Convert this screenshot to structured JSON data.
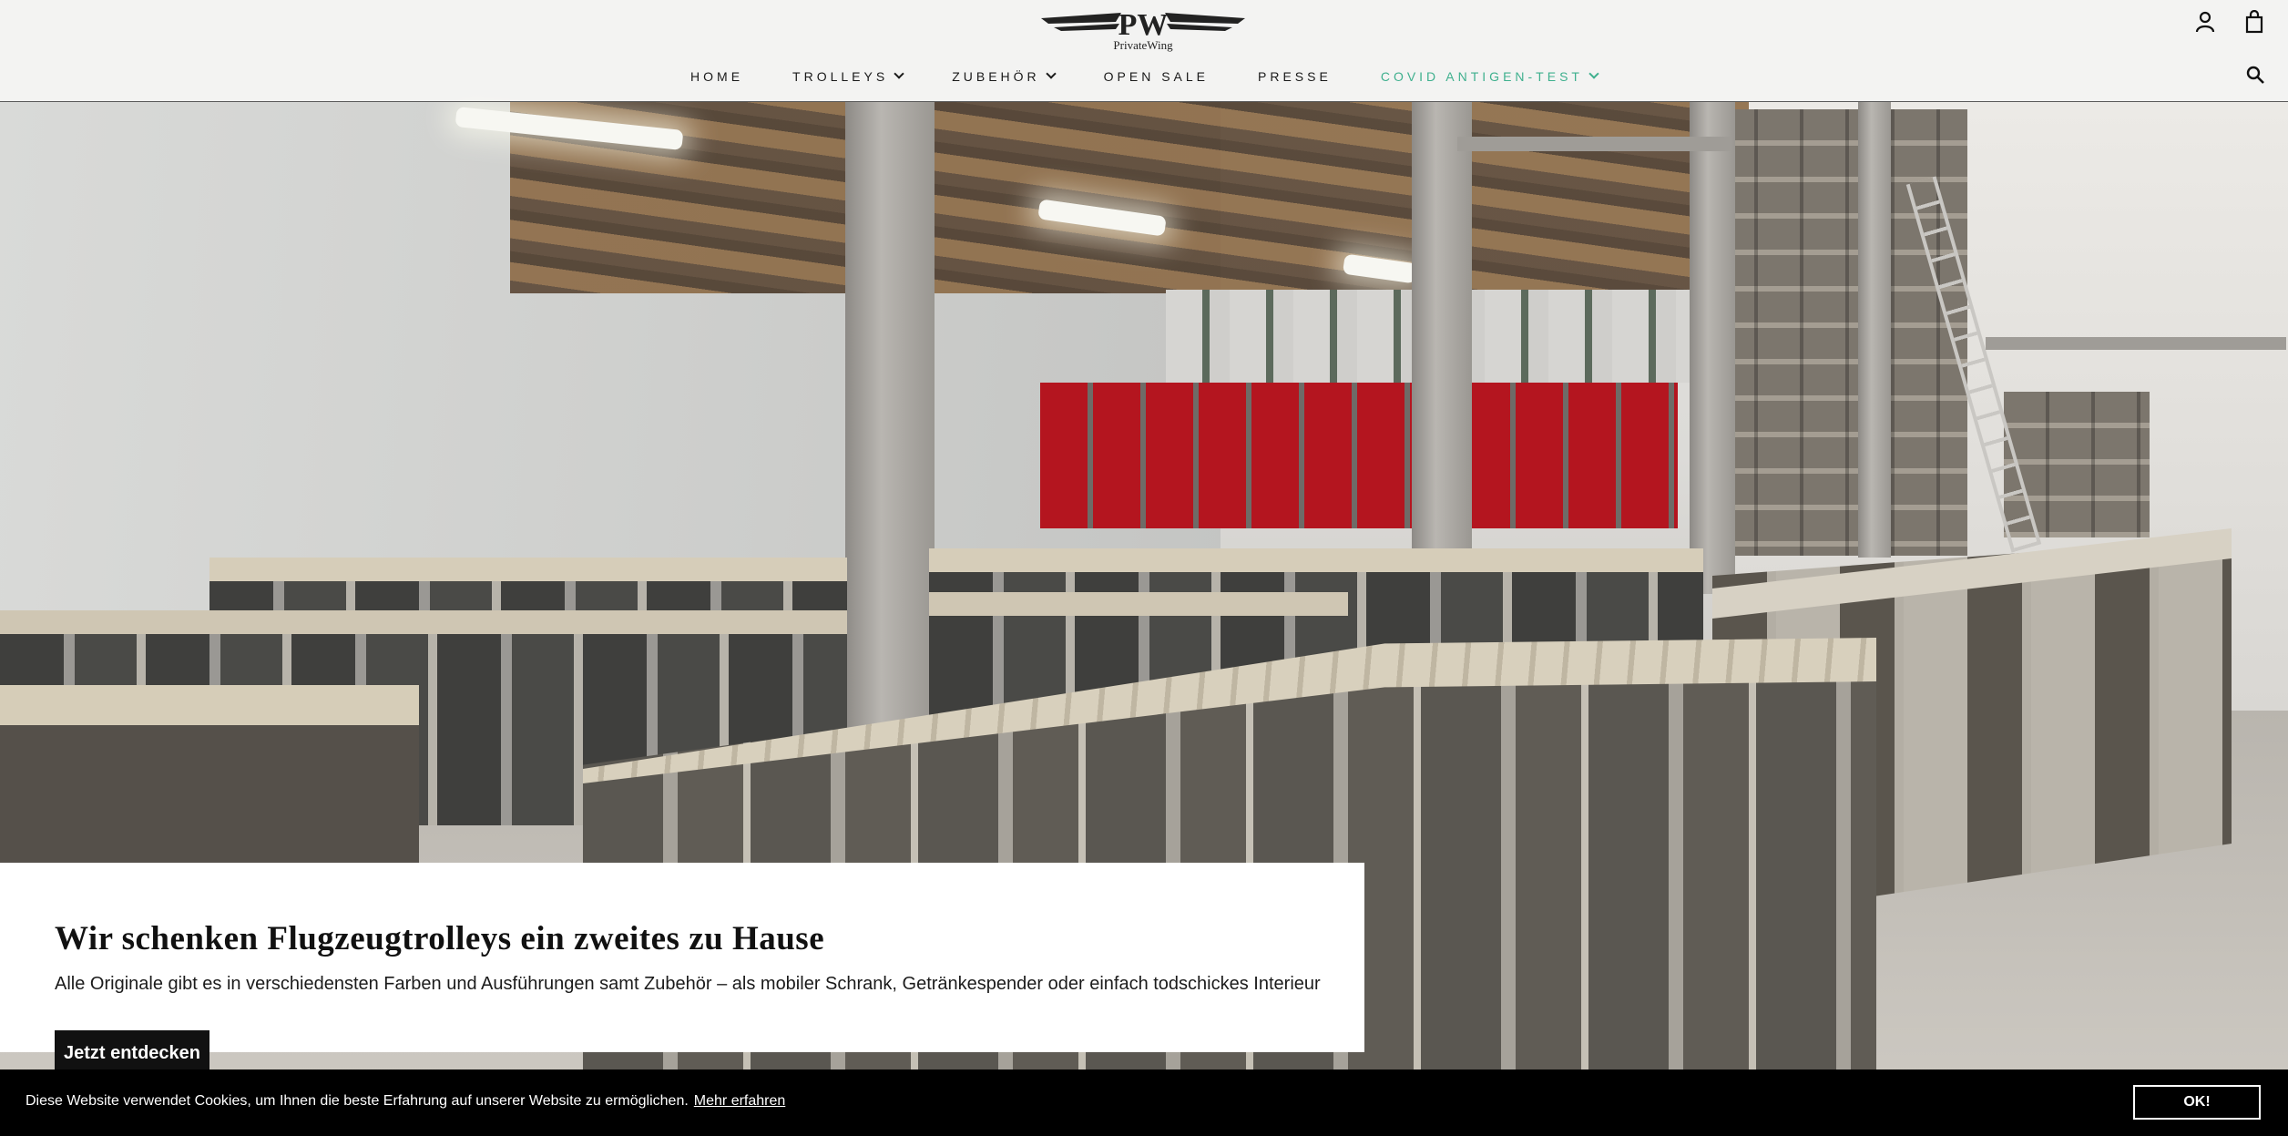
{
  "brand": {
    "logo_text": "PrivateWing",
    "monogram": "PW"
  },
  "nav": {
    "items": [
      {
        "label": "HOME",
        "has_dropdown": false
      },
      {
        "label": "TROLLEYS",
        "has_dropdown": true
      },
      {
        "label": "ZUBEHÖR",
        "has_dropdown": true
      },
      {
        "label": "OPEN SALE",
        "has_dropdown": false
      },
      {
        "label": "PRESSE",
        "has_dropdown": false
      },
      {
        "label": "COVID ANTIGEN-TEST",
        "has_dropdown": true
      }
    ],
    "accent_color": "#3fb08e"
  },
  "header_icons": [
    "account-icon",
    "cart-icon",
    "search-icon"
  ],
  "hero": {
    "title": "Wir schenken Flugzeugtrolleys ein zweites zu Hause",
    "subtitle": "Alle Originale gibt es in verschiedensten Farben und Ausführungen samt Zubehör – als mobiler Schrank, Getränkespender oder einfach todschickes Interieur",
    "cta_label": "Jetzt entdecken"
  },
  "cookie": {
    "text": "Diese Website verwendet Cookies, um Ihnen die beste Erfahrung auf unserer Website zu ermöglichen.",
    "link_label": "Mehr erfahren",
    "button_label": "OK!"
  }
}
